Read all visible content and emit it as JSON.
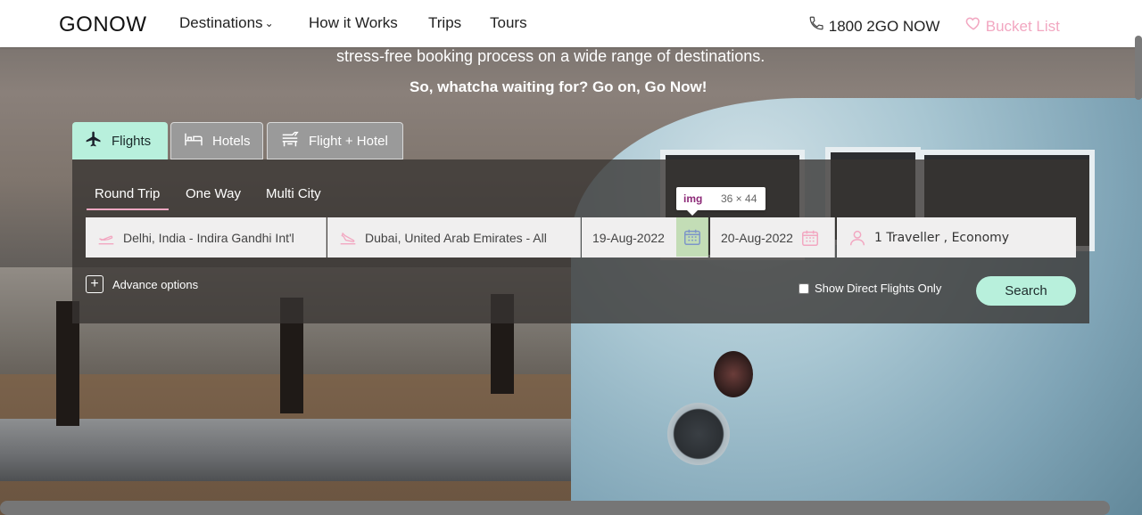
{
  "header": {
    "logo": "GONOW",
    "nav": [
      {
        "label": "Destinations"
      },
      {
        "label": "How it Works"
      },
      {
        "label": "Trips"
      },
      {
        "label": "Tours"
      }
    ],
    "phone": "1800 2GO NOW",
    "bucket_list": "Bucket List"
  },
  "hero": {
    "tagline": "stress-free booking process on a wide range of destinations.",
    "subtagline": "So, whatcha waiting for? Go on, Go Now!"
  },
  "tabs": {
    "flights": "Flights",
    "hotels": "Hotels",
    "flight_hotel": "Flight + Hotel"
  },
  "trip_type": {
    "round_trip": "Round Trip",
    "one_way": "One Way",
    "multi_city": "Multi City"
  },
  "fields": {
    "from": "Delhi, India - Indira Gandhi Int'l",
    "to": "Dubai, United Arab Emirates - All",
    "depart": "19-Aug-2022",
    "return": "20-Aug-2022",
    "travellers": "1 Traveller , Economy"
  },
  "tooltip": {
    "tag": "img",
    "dimensions": "36 × 44"
  },
  "advanced": "Advance options",
  "direct_flights": "Show Direct Flights Only",
  "search": "Search",
  "colors": {
    "accent_pink": "#f2a7c1",
    "accent_mint": "#b8f0dc"
  }
}
